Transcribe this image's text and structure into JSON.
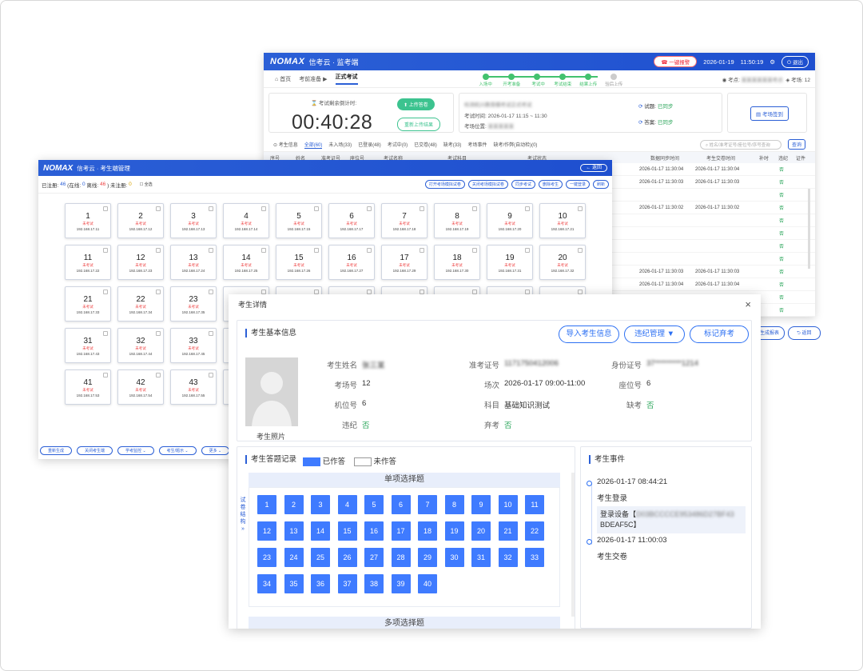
{
  "back": {
    "logo": "NOMAX",
    "title": "信考云 · 监考端",
    "header": {
      "alert": "一键报警",
      "date": "2026-01-19",
      "time": "11:50:19",
      "logout": "退出"
    },
    "nav": {
      "home": "首页",
      "prep": "考前准备",
      "formal": "正式考试",
      "room_label": "考点:",
      "room_value": "某某某某某某考点",
      "site_label": "考场:",
      "site_value": "12"
    },
    "steps": [
      "入场中",
      "开考准备",
      "考试中",
      "考试结束",
      "结果上传",
      "验后上传"
    ],
    "timer": {
      "label": "考试剩余倒计时:",
      "value": "00:40:28",
      "upload": "上传答卷",
      "reupload": "重新上传结果"
    },
    "exam": {
      "name": "检测机兴教育模考试正式考试",
      "time_label": "考试时间:",
      "time_value": "2026-01-17 11:15 ~ 11:30",
      "place_label": "考场位置:",
      "place_value": "某某某某某"
    },
    "sync": {
      "q_label": "试题:",
      "q_value": "已同步",
      "a_label": "答案:",
      "a_value": "已同步"
    },
    "checkin": "考场签到",
    "tabs": [
      "考生信息",
      "全部(60)",
      "未入场(33)",
      "已登录(48)",
      "考试中(0)",
      "已交卷(48)",
      "缺考(33)",
      "考场事件",
      "缺考/作弊(自动检)(0)"
    ],
    "search_placeholder": "姓名/准考证号/座位号/序号查询",
    "search_btn": "查询",
    "table_headers": [
      "序号",
      "姓名",
      "准考证号",
      "座位号",
      "考试名称",
      "考试科目",
      "考试状态",
      "数据同步时间",
      "考生交卷时间",
      "补时",
      "违纪",
      "证件"
    ],
    "rows": [
      {
        "sync": "2026-01-17 11:30:04",
        "submit": "2026-01-17 11:30:04",
        "flag": "否"
      },
      {
        "sync": "2026-01-17 11:30:03",
        "submit": "2026-01-17 11:30:03",
        "flag": "否"
      },
      {
        "sync": "",
        "submit": "",
        "flag": "否"
      },
      {
        "sync": "2026-01-17 11:30:02",
        "submit": "2026-01-17 11:30:02",
        "flag": "否"
      },
      {
        "sync": "",
        "submit": "",
        "flag": "否"
      },
      {
        "sync": "",
        "submit": "",
        "flag": "否"
      },
      {
        "sync": "",
        "submit": "",
        "flag": "否"
      },
      {
        "sync": "",
        "submit": "",
        "flag": "否"
      },
      {
        "sync": "2026-01-17 11:30:03",
        "submit": "2026-01-17 11:30:03",
        "flag": "否"
      },
      {
        "sync": "2026-01-17 11:30:04",
        "submit": "2026-01-17 11:30:04",
        "flag": "否"
      },
      {
        "sync": "",
        "submit": "",
        "flag": "否"
      },
      {
        "sync": "",
        "submit": "",
        "flag": "否"
      }
    ],
    "bottom_btns": [
      "生成报表",
      "返回"
    ]
  },
  "mid": {
    "logo": "NOMAX",
    "title": "信考云 · 考生端管理",
    "return": "← 返回",
    "stats": {
      "reg_label": "已注册:",
      "reg": "46",
      "online_label": "(在线:",
      "online": "0",
      "offline_label": "离线:",
      "offline": "46",
      "unreg_label": ") 未注册:",
      "unreg": "0",
      "all": "全选"
    },
    "actions": [
      "打开考场模拟试卷",
      "关闭考场模拟试卷",
      "同步考试",
      "删除考生",
      "一键登录",
      "刷新"
    ],
    "seat_status": "未考试",
    "seats": [
      {
        "n": "1",
        "ip": "192.168.17.11"
      },
      {
        "n": "2",
        "ip": "192.168.17.12"
      },
      {
        "n": "3",
        "ip": "192.168.17.13"
      },
      {
        "n": "4",
        "ip": "192.168.17.14"
      },
      {
        "n": "5",
        "ip": "192.168.17.15"
      },
      {
        "n": "6",
        "ip": "192.168.17.17"
      },
      {
        "n": "7",
        "ip": "192.168.17.18"
      },
      {
        "n": "8",
        "ip": "192.168.17.19"
      },
      {
        "n": "9",
        "ip": "192.168.17.20"
      },
      {
        "n": "10",
        "ip": "192.168.17.21"
      },
      {
        "n": "11",
        "ip": "192.168.17.22"
      },
      {
        "n": "12",
        "ip": "192.168.17.23"
      },
      {
        "n": "13",
        "ip": "192.168.17.24"
      },
      {
        "n": "14",
        "ip": "192.168.17.25"
      },
      {
        "n": "15",
        "ip": "192.168.17.26"
      },
      {
        "n": "16",
        "ip": "192.168.17.27"
      },
      {
        "n": "17",
        "ip": "192.168.17.29"
      },
      {
        "n": "18",
        "ip": "192.168.17.30"
      },
      {
        "n": "19",
        "ip": "192.168.17.31"
      },
      {
        "n": "20",
        "ip": "192.168.17.32"
      },
      {
        "n": "21",
        "ip": "192.168.17.33"
      },
      {
        "n": "22",
        "ip": "192.168.17.34"
      },
      {
        "n": "23",
        "ip": "192.168.17.35"
      },
      {
        "n": "31",
        "ip": "192.168.17.43"
      },
      {
        "n": "32",
        "ip": "192.168.17.44"
      },
      {
        "n": "33",
        "ip": "192.168.17.45"
      },
      {
        "n": "41",
        "ip": "192.168.17.53"
      },
      {
        "n": "42",
        "ip": "192.168.17.54"
      },
      {
        "n": "43",
        "ip": "192.168.17.55"
      }
    ],
    "bottom": [
      "重新生成",
      "关闭考生端",
      "学考监控",
      "考生/题示",
      "更多"
    ]
  },
  "dialog": {
    "title": "考生详情",
    "basic_title": "考生基本信息",
    "btn_import": "导入考生信息",
    "btn_violation": "违纪管理 ▼",
    "btn_abandon": "标记弃考",
    "photo_label": "考生照片",
    "fields": {
      "name_l": "考生姓名",
      "name_v": "张三某",
      "ticket_l": "准考证号",
      "ticket_v": "1171750412006",
      "id_l": "身份证号",
      "id_v": "37*********1214",
      "room_l": "考场号",
      "room_v": "12",
      "session_l": "场次",
      "session_v": "2026-01-17 09:00-11:00",
      "seat_l": "座位号",
      "seat_v": "6",
      "machine_l": "机位号",
      "machine_v": "6",
      "subject_l": "科目",
      "subject_v": "基础知识测试",
      "absent_l": "缺考",
      "absent_v": "否",
      "violate_l": "违纪",
      "violate_v": "否",
      "giveup_l": "弃考",
      "giveup_v": "否"
    },
    "answer_title": "考生答题记录",
    "legend_done": "已作答",
    "legend_undone": "未作答",
    "side_tab": "试卷结构",
    "section1": "单项选择题",
    "section2": "多项选择题",
    "questions": [
      "1",
      "2",
      "3",
      "4",
      "5",
      "6",
      "7",
      "8",
      "9",
      "10",
      "11",
      "12",
      "13",
      "14",
      "15",
      "16",
      "17",
      "18",
      "19",
      "20",
      "21",
      "22",
      "23",
      "24",
      "25",
      "26",
      "27",
      "28",
      "29",
      "30",
      "31",
      "32",
      "33",
      "34",
      "35",
      "36",
      "37",
      "38",
      "39",
      "40"
    ],
    "events_title": "考生事件",
    "events": [
      {
        "time": "2026-01-17 08:44:21",
        "text": "考生登录",
        "device_label": "登录设备【",
        "device_id": "D03BCCCCE953486D27BF43",
        "device_tail": "BDEAF5C】"
      },
      {
        "time": "2026-01-17 11:00:03",
        "text": "考生交卷"
      }
    ],
    "colors": {
      "accent": "#2b6ff3",
      "done": "#3f7bff",
      "header": "#2b5fd6",
      "ok": "#2aa55a"
    }
  }
}
